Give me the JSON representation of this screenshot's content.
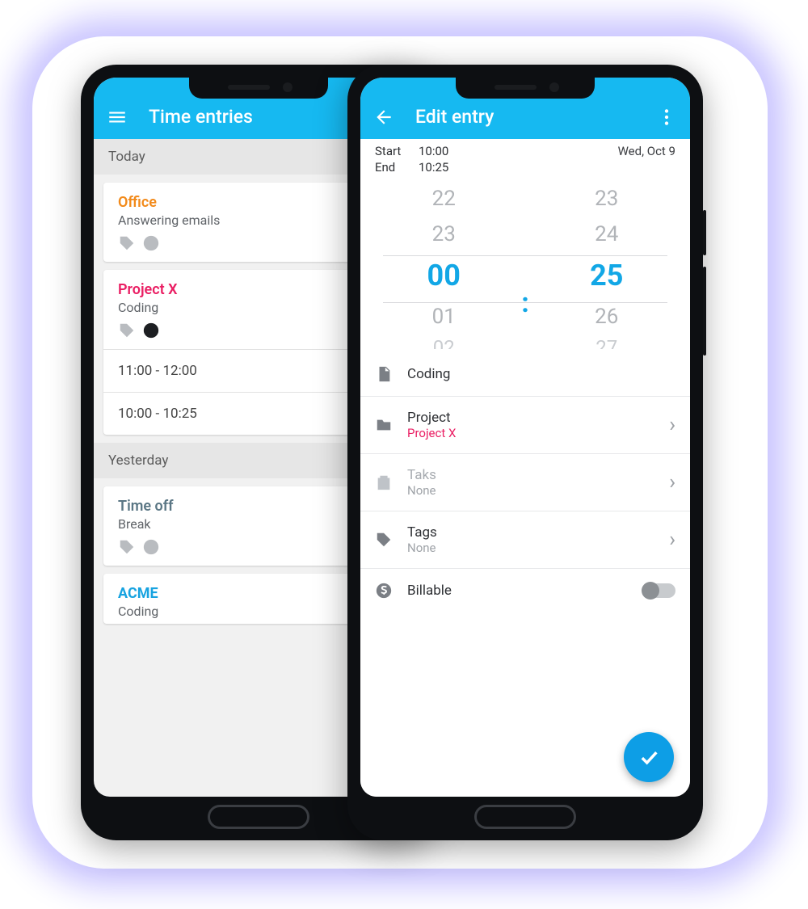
{
  "accent": "#16b9f1",
  "left": {
    "title": "Time entries",
    "sections": [
      {
        "label": "Today",
        "cards": [
          {
            "project": "Office",
            "project_color": "orange",
            "task": "Answering emails",
            "billable": false,
            "times": []
          },
          {
            "project": "Project X",
            "project_color": "magenta",
            "task": "Coding",
            "billable": true,
            "times": [
              "11:00 - 12:00",
              "10:00 - 10:25"
            ]
          }
        ]
      },
      {
        "label": "Yesterday",
        "cards": [
          {
            "project": "Time off",
            "project_color": "slate",
            "task": "Break",
            "billable": false,
            "times": []
          },
          {
            "project": "ACME",
            "project_color": "cyan",
            "task": "Coding",
            "billable": false,
            "times": []
          }
        ]
      }
    ]
  },
  "right": {
    "title": "Edit entry",
    "start_label": "Start",
    "start_value": "10:00",
    "end_label": "End",
    "end_value": "10:25",
    "date": "Wed, Oct 9",
    "picker": {
      "hours": [
        "22",
        "23",
        "00",
        "01",
        "02"
      ],
      "minutes": [
        "23",
        "24",
        "25",
        "26",
        "27"
      ]
    },
    "description": "Coding",
    "project_label": "Project",
    "project_value": "Project X",
    "task_label": "Taks",
    "task_value": "None",
    "tags_label": "Tags",
    "tags_value": "None",
    "billable_label": "Billable",
    "billable": false
  }
}
